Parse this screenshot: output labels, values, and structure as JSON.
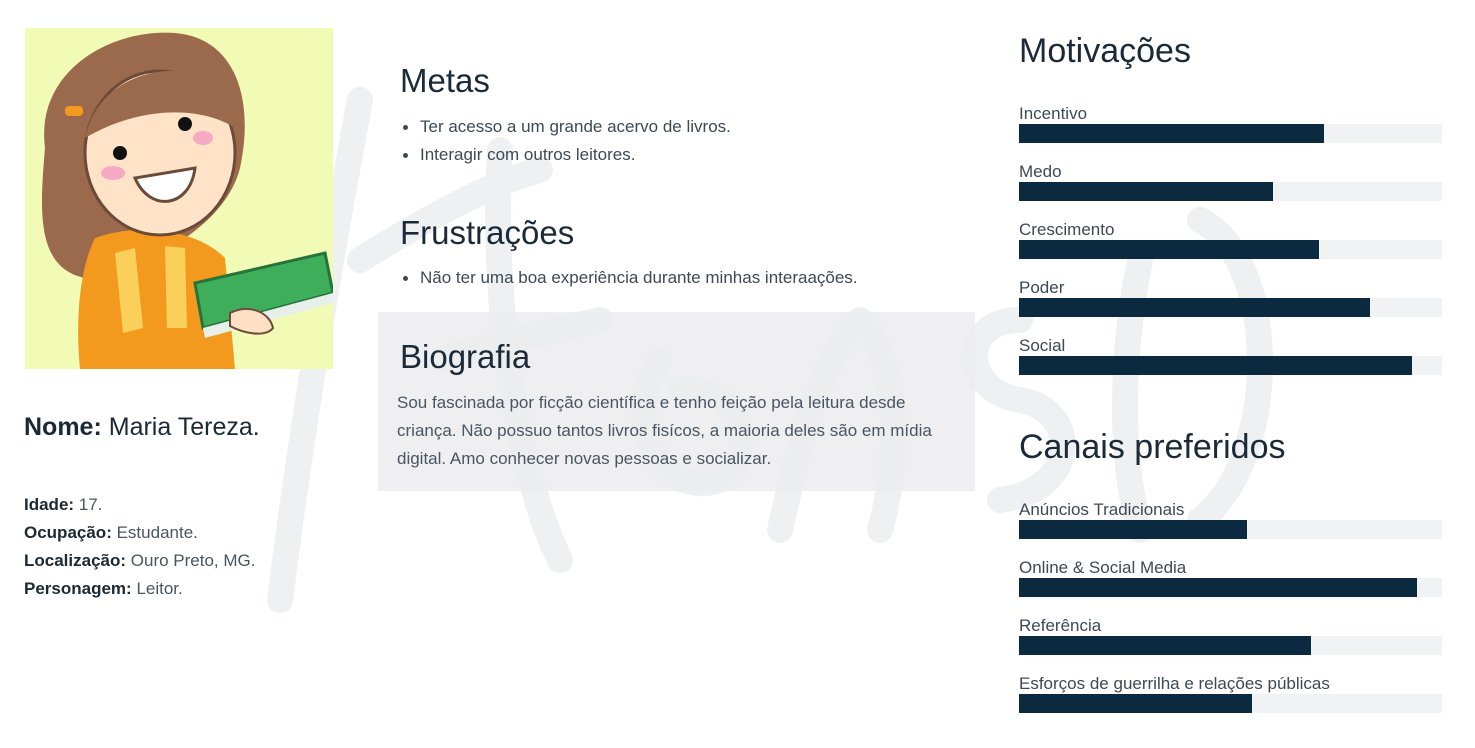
{
  "persona": {
    "name_key": "Nome:",
    "name_value": "Maria Tereza.",
    "facts": [
      {
        "key": "Idade:",
        "value": "17."
      },
      {
        "key": "Ocupação:",
        "value": "Estudante."
      },
      {
        "key": "Localização:",
        "value": "Ouro Preto, MG."
      },
      {
        "key": "Personagem:",
        "value": "Leitor."
      }
    ]
  },
  "goals": {
    "title": "Metas",
    "items": [
      "Ter acesso a um grande acervo de livros.",
      "Interagir com outros leitores."
    ]
  },
  "frustrations": {
    "title": "Frustrações",
    "items": [
      "Não ter uma boa experiência durante minhas interaações."
    ]
  },
  "biography": {
    "title": "Biografia",
    "text": "Sou fascinada por ficção científica e tenho feição pela leitura desde criança. Não possuo tantos livros fisícos, a maioria deles são em mídia digital. Amo conhecer novas pessoas e socializar."
  },
  "motivations": {
    "title": "Motivações",
    "bars": [
      {
        "label": "Incentivo",
        "fraction": 0.72
      },
      {
        "label": "Medo",
        "fraction": 0.6
      },
      {
        "label": "Crescimento",
        "fraction": 0.71
      },
      {
        "label": "Poder",
        "fraction": 0.83
      },
      {
        "label": "Social",
        "fraction": 0.93
      }
    ]
  },
  "channels": {
    "title": "Canais preferidos",
    "bars": [
      {
        "label": "Anúncios Tradicionais",
        "fraction": 0.54
      },
      {
        "label": "Online & Social Media",
        "fraction": 0.94
      },
      {
        "label": "Referência",
        "fraction": 0.69
      },
      {
        "label": "Esforços de guerrilha e relações públicas",
        "fraction": 0.55
      }
    ]
  },
  "colors": {
    "bar_fill": "#0b2a40",
    "bar_track": "#f1f2f3",
    "avatar_bg": "#f2fbb6"
  }
}
